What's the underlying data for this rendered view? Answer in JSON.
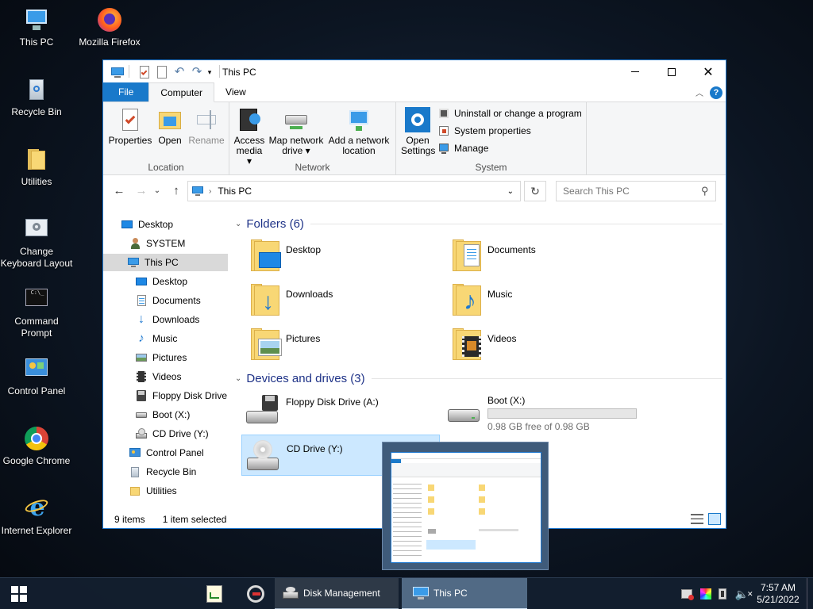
{
  "desktop": {
    "icons": [
      {
        "label": "This PC"
      },
      {
        "label": "Mozilla Firefox"
      },
      {
        "label": "Recycle Bin"
      },
      {
        "label": "Utilities"
      },
      {
        "label": "Change Keyboard Layout"
      },
      {
        "label": "Command Prompt"
      },
      {
        "label": "Control Panel"
      },
      {
        "label": "Google Chrome"
      },
      {
        "label": "Internet Explorer"
      }
    ]
  },
  "window": {
    "title": "This PC",
    "tabs": [
      "File",
      "Computer",
      "View"
    ],
    "ribbon": {
      "location": {
        "label": "Location",
        "buttons": [
          "Properties",
          "Open",
          "Rename"
        ]
      },
      "network": {
        "label": "Network",
        "buttons": [
          "Access media ▾",
          "Map network drive ▾",
          "Add a network location"
        ]
      },
      "system": {
        "label": "System",
        "open_settings": "Open Settings",
        "items": [
          "Uninstall or change a program",
          "System properties",
          "Manage"
        ]
      }
    },
    "address": {
      "path": "This PC",
      "search_placeholder": "Search This PC"
    },
    "tree": [
      {
        "label": "Desktop",
        "icon": "desktop-icon"
      },
      {
        "label": "SYSTEM",
        "icon": "user-icon"
      },
      {
        "label": "This PC",
        "icon": "pc-icon"
      },
      {
        "label": "Desktop",
        "icon": "desktop-icon"
      },
      {
        "label": "Documents",
        "icon": "documents-icon"
      },
      {
        "label": "Downloads",
        "icon": "downloads-icon"
      },
      {
        "label": "Music",
        "icon": "music-icon"
      },
      {
        "label": "Pictures",
        "icon": "pictures-icon"
      },
      {
        "label": "Videos",
        "icon": "videos-icon"
      },
      {
        "label": "Floppy Disk Drive",
        "icon": "floppy-icon"
      },
      {
        "label": "Boot (X:)",
        "icon": "drive-icon"
      },
      {
        "label": "CD Drive (Y:)",
        "icon": "cd-icon"
      },
      {
        "label": "Control Panel",
        "icon": "control-panel-icon"
      },
      {
        "label": "Recycle Bin",
        "icon": "recycle-bin-icon"
      },
      {
        "label": "Utilities",
        "icon": "folder-icon"
      }
    ],
    "folders_header": "Folders (6)",
    "folders": [
      "Desktop",
      "Documents",
      "Downloads",
      "Music",
      "Pictures",
      "Videos"
    ],
    "devices_header": "Devices and drives (3)",
    "drives": [
      {
        "name": "Floppy Disk Drive (A:)"
      },
      {
        "name": "Boot (X:)",
        "free": "0.98 GB free of 0.98 GB",
        "used_fraction": 0.0
      },
      {
        "name": "CD Drive (Y:)"
      }
    ],
    "status": {
      "items": "9 items",
      "selected": "1 item selected"
    }
  },
  "taskbar": {
    "buttons": [
      "Disk Management",
      "This PC"
    ],
    "time": "7:57 AM",
    "date": "5/21/2022"
  },
  "colors": {
    "accent": "#1979ca",
    "selection": "#cce8ff",
    "taskbar": "#142030"
  }
}
